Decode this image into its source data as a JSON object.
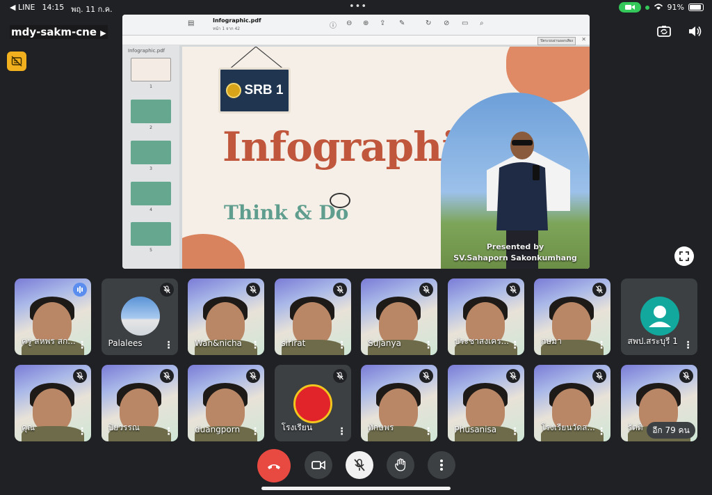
{
  "status_bar": {
    "back_app": "◀ LINE",
    "time": "14:15",
    "date": "พฤ. 11 ก.ค.",
    "battery": "91%"
  },
  "meeting": {
    "code": "mdy-sakm-cne"
  },
  "shared_screen": {
    "file_name": "Infographic.pdf",
    "page_info": "หน้า 1 จาก 42",
    "sidebar_title": "Infographic.pdf",
    "thumbnail_numbers": [
      "1",
      "2",
      "3",
      "4",
      "5"
    ],
    "notice_button": "ปิดระบบอ่านออกเสียง",
    "slide": {
      "sign_text": "SRB 1",
      "title": "Infographic",
      "subtitle": "Think & Do",
      "presented_by_label": "Presented by",
      "presenter": "SV.Sahaporn Sakonkumhang"
    }
  },
  "participants_row1": [
    {
      "name": "ครู สหพร สก...",
      "type": "camera",
      "speaking": true
    },
    {
      "name": "Palalees",
      "type": "photo",
      "muted": true
    },
    {
      "name": "Wan&nicha",
      "type": "camera",
      "muted": true
    },
    {
      "name": "sirirat",
      "type": "camera",
      "muted": true
    },
    {
      "name": "Sujanya",
      "type": "camera",
      "muted": true
    },
    {
      "name": "ประชาสงเคร...",
      "type": "camera",
      "muted": true
    },
    {
      "name": "กษมา",
      "type": "camera",
      "muted": true
    },
    {
      "name": "สพป.สระบุรี 1",
      "type": "avatar"
    }
  ],
  "participants_row2": [
    {
      "name": "คุณ",
      "type": "camera",
      "muted": true
    },
    {
      "name": "ปิยวรรณ",
      "type": "camera",
      "muted": true
    },
    {
      "name": "duangporn",
      "type": "camera",
      "muted": true
    },
    {
      "name": "โรงเรียน",
      "type": "logo",
      "muted": true
    },
    {
      "name": "ทักษพร",
      "type": "camera",
      "muted": true
    },
    {
      "name": "Phusanisa",
      "type": "camera",
      "muted": true
    },
    {
      "name": "โรงเรียนวัดส...",
      "type": "camera",
      "muted": true
    },
    {
      "name": "รัตติ",
      "type": "camera",
      "muted": true
    }
  ],
  "more_participants": "อีก 79 คน",
  "colors": {
    "end_call": "#e84a42",
    "background": "#202124",
    "tile": "#3c4043"
  }
}
